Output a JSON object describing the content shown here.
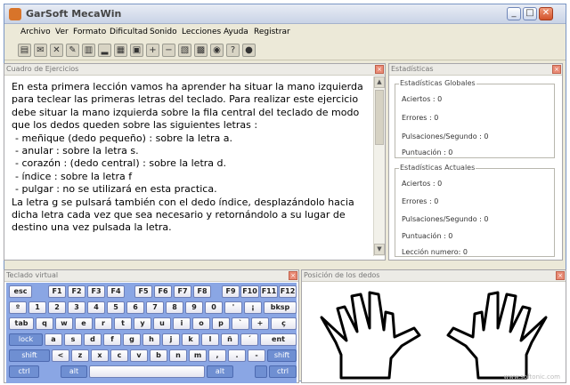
{
  "window": {
    "title": "GarSoft MecaWin",
    "controls": {
      "minimize": "_",
      "maximize": "□",
      "close": "✕"
    }
  },
  "menu": [
    "Archivo",
    "Ver",
    "Formato",
    "Dificultad",
    "Sonido",
    "Lecciones",
    "Ayuda",
    "Registrar"
  ],
  "toolbar": {
    "icons": [
      "folder-open-icon",
      "email-icon",
      "delete-icon",
      "brush-icon",
      "document-icon",
      "chart-icon",
      "page-icon",
      "print-icon",
      "add-icon",
      "minus-icon",
      "open-file-icon",
      "image-icon",
      "record-icon",
      "help-icon",
      "idea-icon"
    ],
    "glyphs": [
      "▤",
      "✉",
      "✕",
      "✎",
      "▥",
      "▂",
      "▦",
      "▣",
      "+",
      "−",
      "▧",
      "▩",
      "◉",
      "?",
      "●"
    ]
  },
  "exercise": {
    "title": "Cuadro de Ejercicios",
    "lines": [
      "En esta primera lección vamos ha aprender ha situar la mano izquierda",
      "para teclear las primeras letras del teclado. Para realizar este ejercicio",
      "debe situar la mano izquierda sobre la fila central del teclado de modo",
      "que los dedos queden sobre las siguientes letras :",
      "- meñique (dedo pequeño) : sobre la letra a.",
      "- anular : sobre la letra s.",
      "- corazón : (dedo central) : sobre la letra d.",
      "- índice : sobre la letra f",
      "- pulgar : no se utilizará en esta practica.",
      "La letra g se pulsará también con el dedo índice, desplazándolo hacia",
      "dicha letra cada vez que sea necesario y retornándolo a su lugar de",
      "destino una vez pulsada la letra."
    ],
    "scroll_up": "▲",
    "scroll_down": "▼"
  },
  "stats": {
    "title": "Estadísticas",
    "global": {
      "title": "Estadísticas Globales",
      "aciertos": "Aciertos :   0",
      "errores": "Errores :   0",
      "pulsaciones": "Pulsaciones/Segundo :   0",
      "puntuacion": "Puntuación :  0"
    },
    "actual": {
      "title": "Estadísticas Actuales",
      "aciertos": "Aciertos :   0",
      "errores": "Errores :   0",
      "pulsaciones": "Pulsaciones/Segundo :   0",
      "puntuacion": "Puntuación :  0",
      "leccion": "Lección numero: 0"
    }
  },
  "keyboard": {
    "title": "Teclado virtual",
    "rows": [
      [
        "esc",
        "F1",
        "F2",
        "F3",
        "F4",
        "F5",
        "F6",
        "F7",
        "F8",
        "F9",
        "F10",
        "F11",
        "F12"
      ],
      [
        "º",
        "1",
        "2",
        "3",
        "4",
        "5",
        "6",
        "7",
        "8",
        "9",
        "0",
        "'",
        "¡",
        "bksp"
      ],
      [
        "tab",
        "q",
        "w",
        "e",
        "r",
        "t",
        "y",
        "u",
        "i",
        "o",
        "p",
        "`",
        "+",
        "ç"
      ],
      [
        "lock",
        "a",
        "s",
        "d",
        "f",
        "g",
        "h",
        "j",
        "k",
        "l",
        "ñ",
        "´",
        "ent"
      ],
      [
        "shift",
        "<",
        "z",
        "x",
        "c",
        "v",
        "b",
        "n",
        "m",
        ",",
        ".",
        "-",
        "shift"
      ],
      [
        "ctrl",
        "alt",
        "",
        "alt",
        "",
        "ctrl"
      ]
    ]
  },
  "fingers": {
    "title": "Posición de los dedos"
  },
  "watermark": "www.softonic.com"
}
